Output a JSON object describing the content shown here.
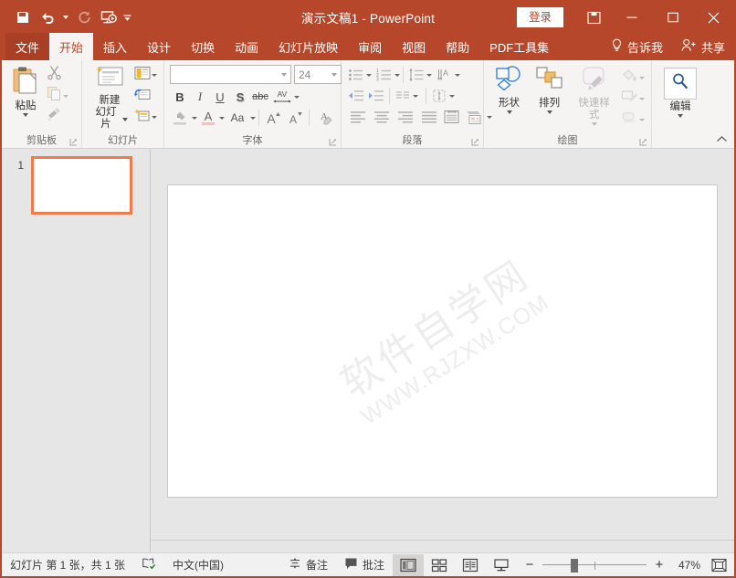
{
  "titlebar": {
    "document_title": "演示文稿1  -  PowerPoint",
    "signin_label": "登录",
    "quick_access": [
      {
        "name": "save",
        "icon": "save-icon"
      },
      {
        "name": "undo",
        "icon": "undo-icon"
      },
      {
        "name": "redo",
        "icon": "redo-icon"
      },
      {
        "name": "start-slideshow",
        "icon": "slideshow-icon"
      },
      {
        "name": "customize-quick-access",
        "icon": "chevron-down-icon"
      }
    ],
    "window_controls": {
      "ribbon_display_options": "ribbon-display-options-icon",
      "minimize": "minimize-icon",
      "maximize": "maximize-icon",
      "close": "close-icon"
    }
  },
  "tabs": [
    {
      "label": "文件",
      "kind": "file"
    },
    {
      "label": "开始",
      "kind": "active"
    },
    {
      "label": "插入",
      "kind": "normal"
    },
    {
      "label": "设计",
      "kind": "normal"
    },
    {
      "label": "切换",
      "kind": "normal"
    },
    {
      "label": "动画",
      "kind": "normal"
    },
    {
      "label": "幻灯片放映",
      "kind": "normal"
    },
    {
      "label": "审阅",
      "kind": "normal"
    },
    {
      "label": "视图",
      "kind": "normal"
    },
    {
      "label": "帮助",
      "kind": "normal"
    },
    {
      "label": "PDF工具集",
      "kind": "normal"
    }
  ],
  "tab_right": {
    "tell_me": "告诉我",
    "share": "共享"
  },
  "ribbon": {
    "groups": [
      {
        "name": "clipboard",
        "label": "剪贴板"
      },
      {
        "name": "slides",
        "label": "幻灯片"
      },
      {
        "name": "font",
        "label": "字体"
      },
      {
        "name": "paragraph",
        "label": "段落"
      },
      {
        "name": "drawing",
        "label": "绘图"
      },
      {
        "name": "editing",
        "label": "编辑"
      }
    ],
    "clipboard": {
      "paste_label": "粘贴",
      "cut_name": "cut-icon",
      "copy_name": "copy-icon",
      "format_painter_name": "format-painter-icon"
    },
    "slides": {
      "new_slide_label": "新建\n幻灯片",
      "new_slide_line1": "新建",
      "new_slide_line2": "幻灯片",
      "layout_name": "layout-icon",
      "reset_name": "reset-icon",
      "section_name": "section-icon"
    },
    "font": {
      "font_name_value": "",
      "font_name_placeholder": "",
      "font_size_value": "24",
      "bold": "B",
      "italic": "I",
      "underline": "U",
      "shadow": "S",
      "strikethrough": "abc",
      "char_spacing": "AV",
      "change_case": "Aa",
      "font_color": "A",
      "grow_font": "A",
      "shrink_font": "A",
      "clear_formatting": "clear-formatting-icon"
    },
    "editing": {
      "label": "编辑",
      "icon": "search-icon"
    },
    "drawing": {
      "shapes_label": "形状",
      "arrange_label": "排列",
      "quick_styles_label": "快速样式",
      "shape_fill": "shape-fill-icon",
      "shape_outline": "shape-outline-icon",
      "shape_effects": "shape-effects-icon"
    },
    "collapse_ribbon": "collapse-ribbon-icon"
  },
  "slides_pane": {
    "slide_number": "1"
  },
  "slide": {
    "watermark_cn": "软件自学网",
    "watermark_en": "WWW.RJZXW.COM"
  },
  "statusbar": {
    "slide_count_text": "幻灯片 第 1 张，共 1 张",
    "spellcheck_icon": "spellcheck-icon",
    "language": "中文(中国)",
    "notes_label": "备注",
    "comments_label": "批注",
    "views": [
      {
        "name": "normal-view",
        "icon": "normal-view-icon",
        "active": true
      },
      {
        "name": "slide-sorter-view",
        "icon": "slide-sorter-icon",
        "active": false
      },
      {
        "name": "reading-view",
        "icon": "reading-view-icon",
        "active": false
      },
      {
        "name": "slideshow-view",
        "icon": "slideshow-icon",
        "active": false
      }
    ],
    "zoom_out": "−",
    "zoom_in": "+",
    "zoom_level": "47%",
    "fit_to_window": "fit-window-icon"
  },
  "colors": {
    "accent": "#b7472a",
    "ribbon_bg": "#f5f4f2",
    "thumb_border": "#ed7d4e",
    "workspace_bg": "#e6e6e6"
  }
}
